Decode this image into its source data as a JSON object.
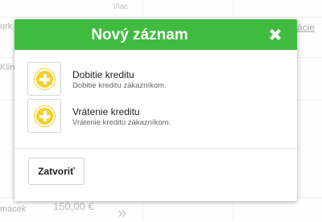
{
  "background": {
    "column_header": "Viac",
    "row1_text": "urk",
    "row2_text": "Kling",
    "row1_link": "ácie",
    "bottom_name": "macek",
    "bottom_price": "150,00 €",
    "chevron": "»"
  },
  "modal": {
    "title": "Nový záznam",
    "close_icon": "close-icon",
    "options": [
      {
        "title": "Dobitie kreditu",
        "description": "Dobitie kreditu zákazníkom.",
        "icon": "plus-circle-icon"
      },
      {
        "title": "Vrátenie kreditu",
        "description": "Vrátenie kreditu zákazníkom.",
        "icon": "plus-circle-icon"
      }
    ],
    "close_button_label": "Zatvoriť"
  },
  "colors": {
    "header_green": "#3fbc3f",
    "icon_yellow": "#f2cf2b"
  }
}
